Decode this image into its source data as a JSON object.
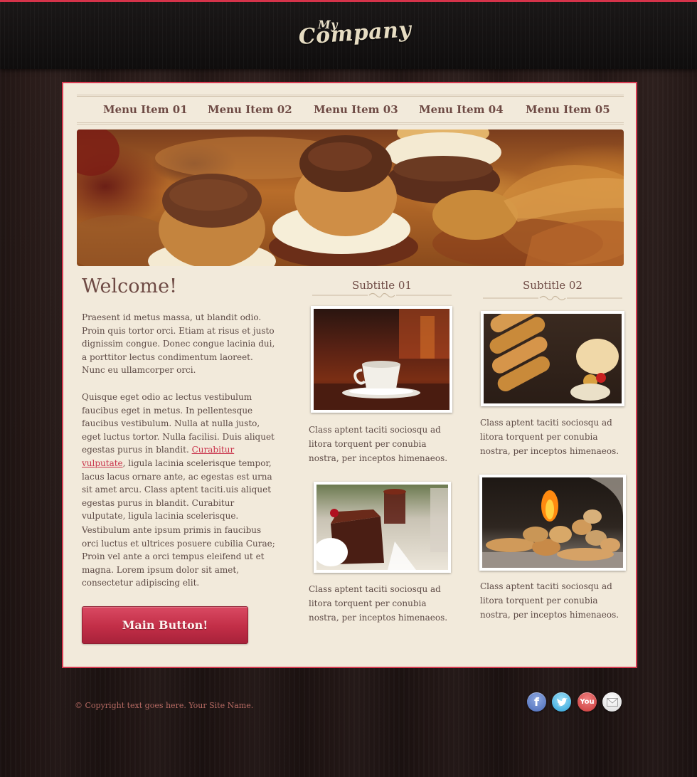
{
  "header": {
    "logo_line1": "My",
    "logo_line2": "Company"
  },
  "nav": {
    "items": [
      "Menu Item 01",
      "Menu Item 02",
      "Menu Item 03",
      "Menu Item 04",
      "Menu Item 05"
    ]
  },
  "main": {
    "welcome": "Welcome!",
    "para1": "Praesent id metus massa, ut blandit odio. Proin quis tortor orci. Etiam at risus et justo dignissim congue. Donec congue lacinia dui, a porttitor lectus condimentum laoreet. Nunc eu ullamcorper orci.",
    "para2_before": "Quisque eget odio ac lectus vestibulum faucibus eget in metus. In pellentesque faucibus vestibulum. Nulla at nulla justo, eget luctus tortor. Nulla facilisi. Duis aliquet egestas purus in blandit. ",
    "para2_link": "Curabitur vulputate",
    "para2_after": ", ligula lacinia scelerisque tempor, lacus lacus ornare ante, ac egestas est urna sit amet arcu. Class aptent taciti.uis aliquet egestas purus in blandit. Curabitur vulputate, ligula lacinia scelerisque.",
    "para3": "Vestibulum ante ipsum primis in faucibus orci luctus et ultrices posuere cubilia Curae; Proin vel ante a orci tempus eleifend ut et magna. Lorem ipsum dolor sit amet, consectetur adipiscing elit.",
    "button": "Main Button!"
  },
  "columns": {
    "subtitle1": "Subtitle 01",
    "subtitle2": "Subtitle 02",
    "caption": "Class aptent taciti sociosqu ad litora torquent per conubia nostra, per inceptos himenaeos."
  },
  "footer": {
    "copyright": "© Copyright text goes here. Your Site Name.",
    "social": [
      "facebook-icon",
      "twitter-icon",
      "youtube-icon",
      "email-icon"
    ],
    "youtube_label": "You",
    "facebook_label": "f"
  },
  "colors": {
    "accent": "#d6334a",
    "panel": "#f2eadb",
    "text": "#5d4a45",
    "heading": "#6e4a44"
  }
}
